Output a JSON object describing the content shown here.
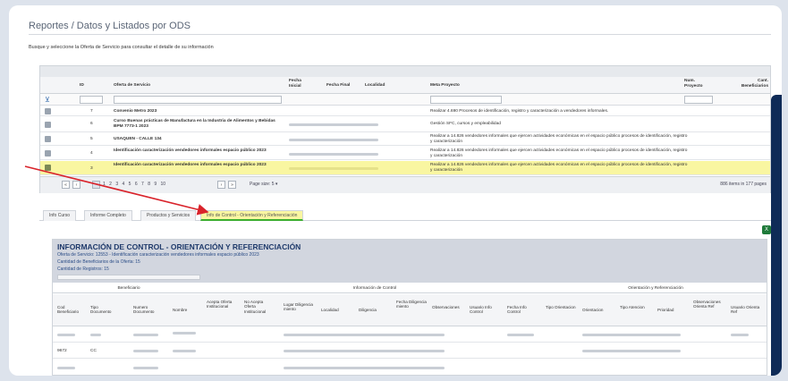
{
  "page": {
    "title": "Reportes / Datos y Listados por ODS",
    "instructions": "Busque y seleccione la Oferta de Servicio para consultar el detalle de su información"
  },
  "grid": {
    "columns": [
      {
        "key": "id",
        "label": "ID"
      },
      {
        "key": "oferta",
        "label": "Oferta de Servicio"
      },
      {
        "key": "fecha_inicial",
        "label": "Fecha Inicial"
      },
      {
        "key": "fecha_final",
        "label": "Fecha Final"
      },
      {
        "key": "localidad",
        "label": "Localidad"
      },
      {
        "key": "meta",
        "label": "Meta Proyecto"
      },
      {
        "key": "num_proyecto",
        "label": "Num. Proyecto"
      },
      {
        "key": "cant_beneficiarios",
        "label": "Cant. Beneficiarios"
      }
    ],
    "rows": [
      {
        "id": "7",
        "oferta": "Convenio Metro 2023",
        "meta": "Realizar 4.690 Procesos de identificación, registro y caracterización a vendedores informales.",
        "selected": false
      },
      {
        "id": "6",
        "oferta": "Curso Buenas prácticas de Manufactura en la Industria de Alimentos y Bebidas BPM 7773-1 2023",
        "meta": "Gestión SFC, cursos y empleabilidad",
        "selected": false
      },
      {
        "id": "5",
        "oferta": "USAQUEN - CALLE 134",
        "meta": "Realizar a 14.826 vendedores informales que ejercen actividades económicas en el espacio público procesos de identificación, registro y caracterización",
        "selected": false
      },
      {
        "id": "4",
        "oferta": "Identificación caracterización vendedores informales espacio público 2023",
        "meta": "Realizar a 14.826 vendedores informales que ejercen actividades económicas en el espacio público procesos de identificación, registro y caracterización",
        "selected": false
      },
      {
        "id": "3",
        "oferta": "Identificación caracterización vendedores informales espacio público 2023",
        "meta": "Realizar a 14.826 vendedores informales que ejercen actividades económicas en el espacio público procesos de identificación, registro y caracterización",
        "selected": true
      }
    ],
    "pager": {
      "first": "«",
      "prev": "‹",
      "pages": "1 2 3 4 5 6 7 8 9 10",
      "next": "›",
      "last": "»",
      "page_size_label": "Page size:",
      "page_size": "5",
      "summary": "886 items in 177 pages"
    }
  },
  "tabs": [
    {
      "label": "Info Curso"
    },
    {
      "label": "Informe Completo"
    },
    {
      "label": "Productos y Servicios"
    },
    {
      "label": "Info de Control - Orientación y Referenciación",
      "active": true
    }
  ],
  "panel": {
    "title": "INFORMACIÓN DE CONTROL - ORIENTACIÓN Y REFERENCIACIÓN",
    "offer_line": "Oferta de Servicio: 12553 - Identificación caracterización vendedores informales espacio público 2023",
    "beneficiaries_line": "Cantidad de Beneficiarios de la Oferta: 15",
    "records_line": "Cantidad de Registros: 15",
    "groups": {
      "beneficiario": "Beneficiario",
      "control": "Información de Control",
      "orientacion": "Orientación y Referenciación"
    },
    "columns": [
      "Cod Beneficiario",
      "Tipo Documento",
      "Numero Documento",
      "Nombre",
      "Acepta Oferta Institucional",
      "No Acepta Oferta Institucional",
      "Lugar Diligenciamiento",
      "Localidad",
      "Diligencia",
      "Fecha Diligenciamiento",
      "Observaciones",
      "Usuario Info Control",
      "Fecha Info Control",
      "Tipo Orientacion",
      "Orientacion",
      "Tipo Atencion",
      "Prioridad",
      "Observaciones Orienta Ref",
      "Usuario Orienta Ref"
    ],
    "rows": [
      {
        "cod": "",
        "tipo": ""
      },
      {
        "cod": "9672",
        "tipo": "CC"
      }
    ]
  }
}
